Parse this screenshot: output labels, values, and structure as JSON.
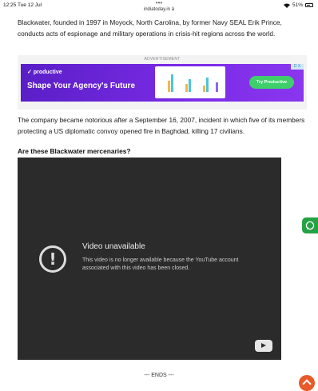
{
  "status_bar": {
    "time": "12:25  Tue 12 Jul",
    "dots": "•••",
    "url": "indiatoday.in",
    "battery": "51%"
  },
  "article": {
    "para1": "Blackwater, founded in 1997 in Moyock, North Carolina, by former Navy SEAL Erik Prince, conducts acts of espionage and military operations in crisis-hit regions across the world.",
    "para2": "The company became notorious after a September 16, 2007, incident in which five of its members protecting a US diplomatic convoy opened fire in Baghdad, killing 17 civilians.",
    "heading": "Are these Blackwater mercenaries?",
    "ends": "--- ENDS ---"
  },
  "ad": {
    "label": "ADVERTISEMENT",
    "brand": "productive",
    "headline": "Shape Your Agency's Future",
    "button": "Try Productive",
    "close": "D X",
    "accent": "#7b2be6",
    "button_color": "#3ecf6a"
  },
  "video": {
    "title": "Video unavailable",
    "message": "This video is no longer available because the YouTube account associated with this video has been closed.",
    "icon": "exclamation-circle-icon"
  },
  "floating": {
    "whatsapp_icon": "whatsapp-icon",
    "scroll_top_icon": "chevron-up-icon"
  }
}
